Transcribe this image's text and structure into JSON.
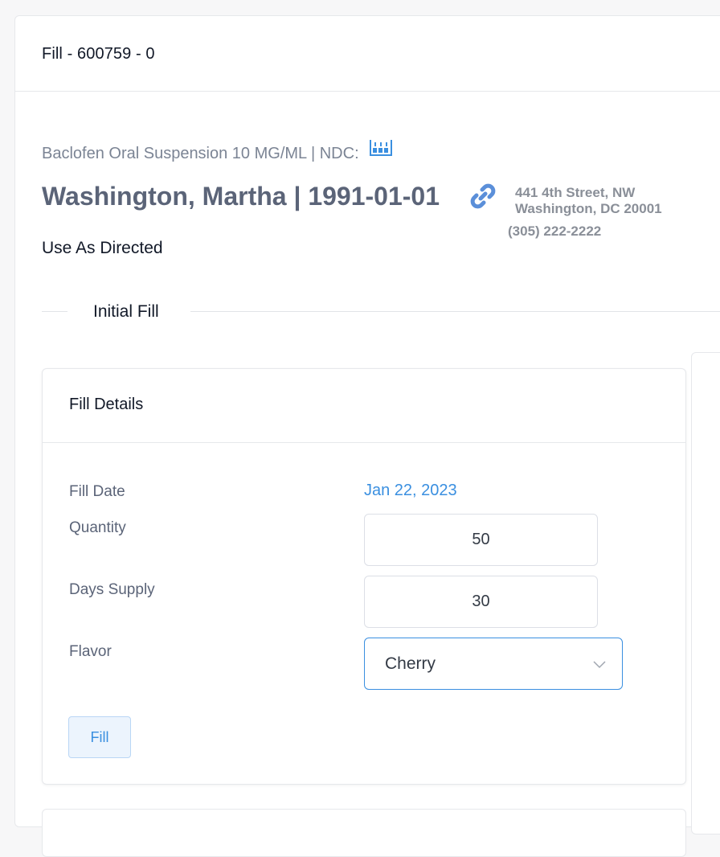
{
  "header": {
    "title": "Fill - 600759 - 0"
  },
  "drug": {
    "description": "Baclofen Oral Suspension 10 MG/ML | NDC:",
    "ndc_icon": "barcode-icon"
  },
  "patient": {
    "name_dob": "Washington, Martha | 1991-01-01",
    "link_icon": "link-icon",
    "address_line1": "441 4th Street, NW",
    "address_line2": "Washington, DC 20001",
    "phone": "(305) 222-2222"
  },
  "directions": "Use As Directed",
  "section": {
    "label": "Initial Fill"
  },
  "fill_details": {
    "title": "Fill Details",
    "fill_date_label": "Fill Date",
    "fill_date_value": "Jan 22, 2023",
    "quantity_label": "Quantity",
    "quantity_value": "50",
    "days_supply_label": "Days Supply",
    "days_supply_value": "30",
    "flavor_label": "Flavor",
    "flavor_value": "Cherry",
    "fill_button": "Fill"
  },
  "colors": {
    "accent": "#3a8fe0",
    "patient_text": "#5b6478",
    "muted_text": "#8a8f98"
  }
}
